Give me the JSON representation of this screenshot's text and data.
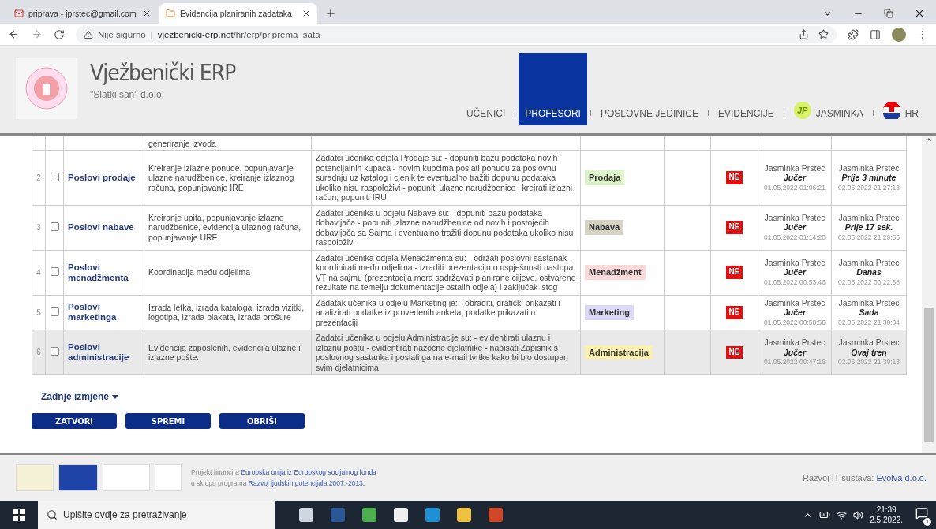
{
  "browser": {
    "tabs": [
      {
        "title": "priprava - jprstec@gmail.com",
        "selected": false
      },
      {
        "title": "Evidencija planiranih zadataka",
        "selected": true
      }
    ],
    "security": "Nije sigurno",
    "separator": "|",
    "url_host": "vjezbenicki-erp.net",
    "url_path": "/hr/erp/priprema_sata"
  },
  "header": {
    "title": "Vježbenički ERP",
    "subtitle": "\"Slatki san\" d.o.o.",
    "nav": [
      {
        "label": "UČENICI",
        "selected": false,
        "kind": "link"
      },
      {
        "label": "PROFESORI",
        "selected": true,
        "kind": "link"
      },
      {
        "label": "POSLOVNE JEDINICE",
        "selected": false,
        "kind": "link"
      },
      {
        "label": "EVIDENCIJE",
        "selected": false,
        "kind": "link"
      },
      {
        "label": "JASMINKA",
        "selected": false,
        "kind": "user",
        "initials": "JP"
      },
      {
        "label": "HR",
        "selected": false,
        "kind": "language"
      }
    ]
  },
  "table": {
    "partial_row": {
      "description": "generiranje izvoda"
    },
    "rows": [
      {
        "number": "2",
        "checked": false,
        "highlighted": false,
        "name": "Poslovi prodaje",
        "description": "Kreiranje izlazne ponude, popunjavanje ulazne narudžbenice, kreiranje izlaznog računa, popunjavanje IRE",
        "tasks": "Zadatci učenika odjela Prodaje su: - dopuniti bazu podataka novih potencijalnih kupaca - novim kupcima poslati ponudu za poslovnu suradnju uz katalog i cjenik te eventualno tražiti dopunu podataka ukoliko nisu raspoloživi - popuniti ulazne narudžbenice i kreirati izlazni račun, popuniti IRU",
        "department": {
          "label": "Prodaja",
          "color": "#ddf5c8"
        },
        "approved": "NE",
        "created": {
          "author": "Jasminka Prstec",
          "relative": "Jučer",
          "timestamp": "01.05.2022 01:06:21"
        },
        "modified": {
          "author": "Jasminka Prstec",
          "relative": "Prije 3 minute",
          "timestamp": "02.05.2022 21:27:13"
        }
      },
      {
        "number": "3",
        "checked": false,
        "highlighted": false,
        "name": "Poslovi nabave",
        "description": "Kreiranje upita, popunjavanje izlazne narudžbenice, evidencija ulaznog računa, popunjavanje URE",
        "tasks": "Zadatci učenika u odjelu Nabave su: - dopuniti bazu podataka dobavljača - popuniti izlazne narudžbenice od novih i postojećih dobavljača sa Sajma i eventualno tražiti dopunu podataka ukoliko nisu raspoloživi",
        "department": {
          "label": "Nabava",
          "color": "#d6d3c4"
        },
        "approved": "NE",
        "created": {
          "author": "Jasminka Prstec",
          "relative": "Jučer",
          "timestamp": "01.05.2022 01:14:20"
        },
        "modified": {
          "author": "Jasminka Prstec",
          "relative": "Prije 17 sek.",
          "timestamp": "02.05.2022 21:29:56"
        }
      },
      {
        "number": "4",
        "checked": false,
        "highlighted": false,
        "name": "Poslovi menadžmenta",
        "description": "Koordinacija među odjelima",
        "tasks": "Zadatci učenika odjela Menadžmenta su: - održati poslovni sastanak - koordinirati među odjelima - izraditi prezentaciju o uspješnosti nastupa VT na sajmu (prezentacija mora sadržavati planirane ciljeve, ostvarene rezultate na temelju dokumentacije ostalih odjela) i zaključak istog",
        "department": {
          "label": "Menadžment",
          "color": "#f9d9d9"
        },
        "approved": "NE",
        "created": {
          "author": "Jasminka Prstec",
          "relative": "Jučer",
          "timestamp": "01.05.2022 00:53:46"
        },
        "modified": {
          "author": "Jasminka Prstec",
          "relative": "Danas",
          "timestamp": "02.05.2022 00:22:58"
        }
      },
      {
        "number": "5",
        "checked": false,
        "highlighted": false,
        "name": "Poslovi marketinga",
        "description": "Izrada letka, izrada kataloga, izrada vizitki, logotipa, izrada plakata, izrada brošure",
        "tasks": "Zadatak učenika u odjelu Marketing je: - obraditi, grafički prikazati i analizirati podatke iz provedenih anketa, podatke prikazati u prezentaciji",
        "department": {
          "label": "Marketing",
          "color": "#dcd9f8"
        },
        "approved": "NE",
        "created": {
          "author": "Jasminka Prstec",
          "relative": "Jučer",
          "timestamp": "01.05.2022 00:58:56"
        },
        "modified": {
          "author": "Jasminka Prstec",
          "relative": "Sada",
          "timestamp": "02.05.2022 21:30:04"
        }
      },
      {
        "number": "6",
        "checked": false,
        "highlighted": true,
        "name": "Poslovi administracije",
        "description": "Evidencija zaposlenih, evidencija ulazne i izlazne pošte.",
        "tasks": "Zadatci učenika u odjelu Administracije su: - evidentirati ulaznu i izlaznu poštu - evidentirati nazočne djelatnike - napisati Zapisnik s poslovnog sastanka i poslati ga na e-mail tvrtke kako bi bio dostupan svim djelatnicima",
        "department": {
          "label": "Administracija",
          "color": "#fcf0b0"
        },
        "approved": "NE",
        "created": {
          "author": "Jasminka Prstec",
          "relative": "Jučer",
          "timestamp": "01.05.2022 00:47:16"
        },
        "modified": {
          "author": "Jasminka Prstec",
          "relative": "Ovaj tren",
          "timestamp": "02.05.2022 21:30:13"
        }
      }
    ]
  },
  "recent_changes": "Zadnje izmjene",
  "buttons": [
    "ZATVORI",
    "SPREMI",
    "OBRIŠI"
  ],
  "footer": {
    "funding": [
      {
        "text": "Projekt financira",
        "link": "Europska unija iz Europskog socijalnog fonda"
      },
      {
        "text": "u sklopu programa",
        "link": "Razvoj ljudskih potencijala 2007.-2013."
      }
    ],
    "credit": "Razvoj IT sustava:",
    "credit_link": "Evolva d.o.o."
  },
  "taskbar": {
    "search_placeholder": "Upišite ovdje za pretraživanje",
    "time": "21:39",
    "date": "2.5.2022.",
    "notifications": "1"
  }
}
